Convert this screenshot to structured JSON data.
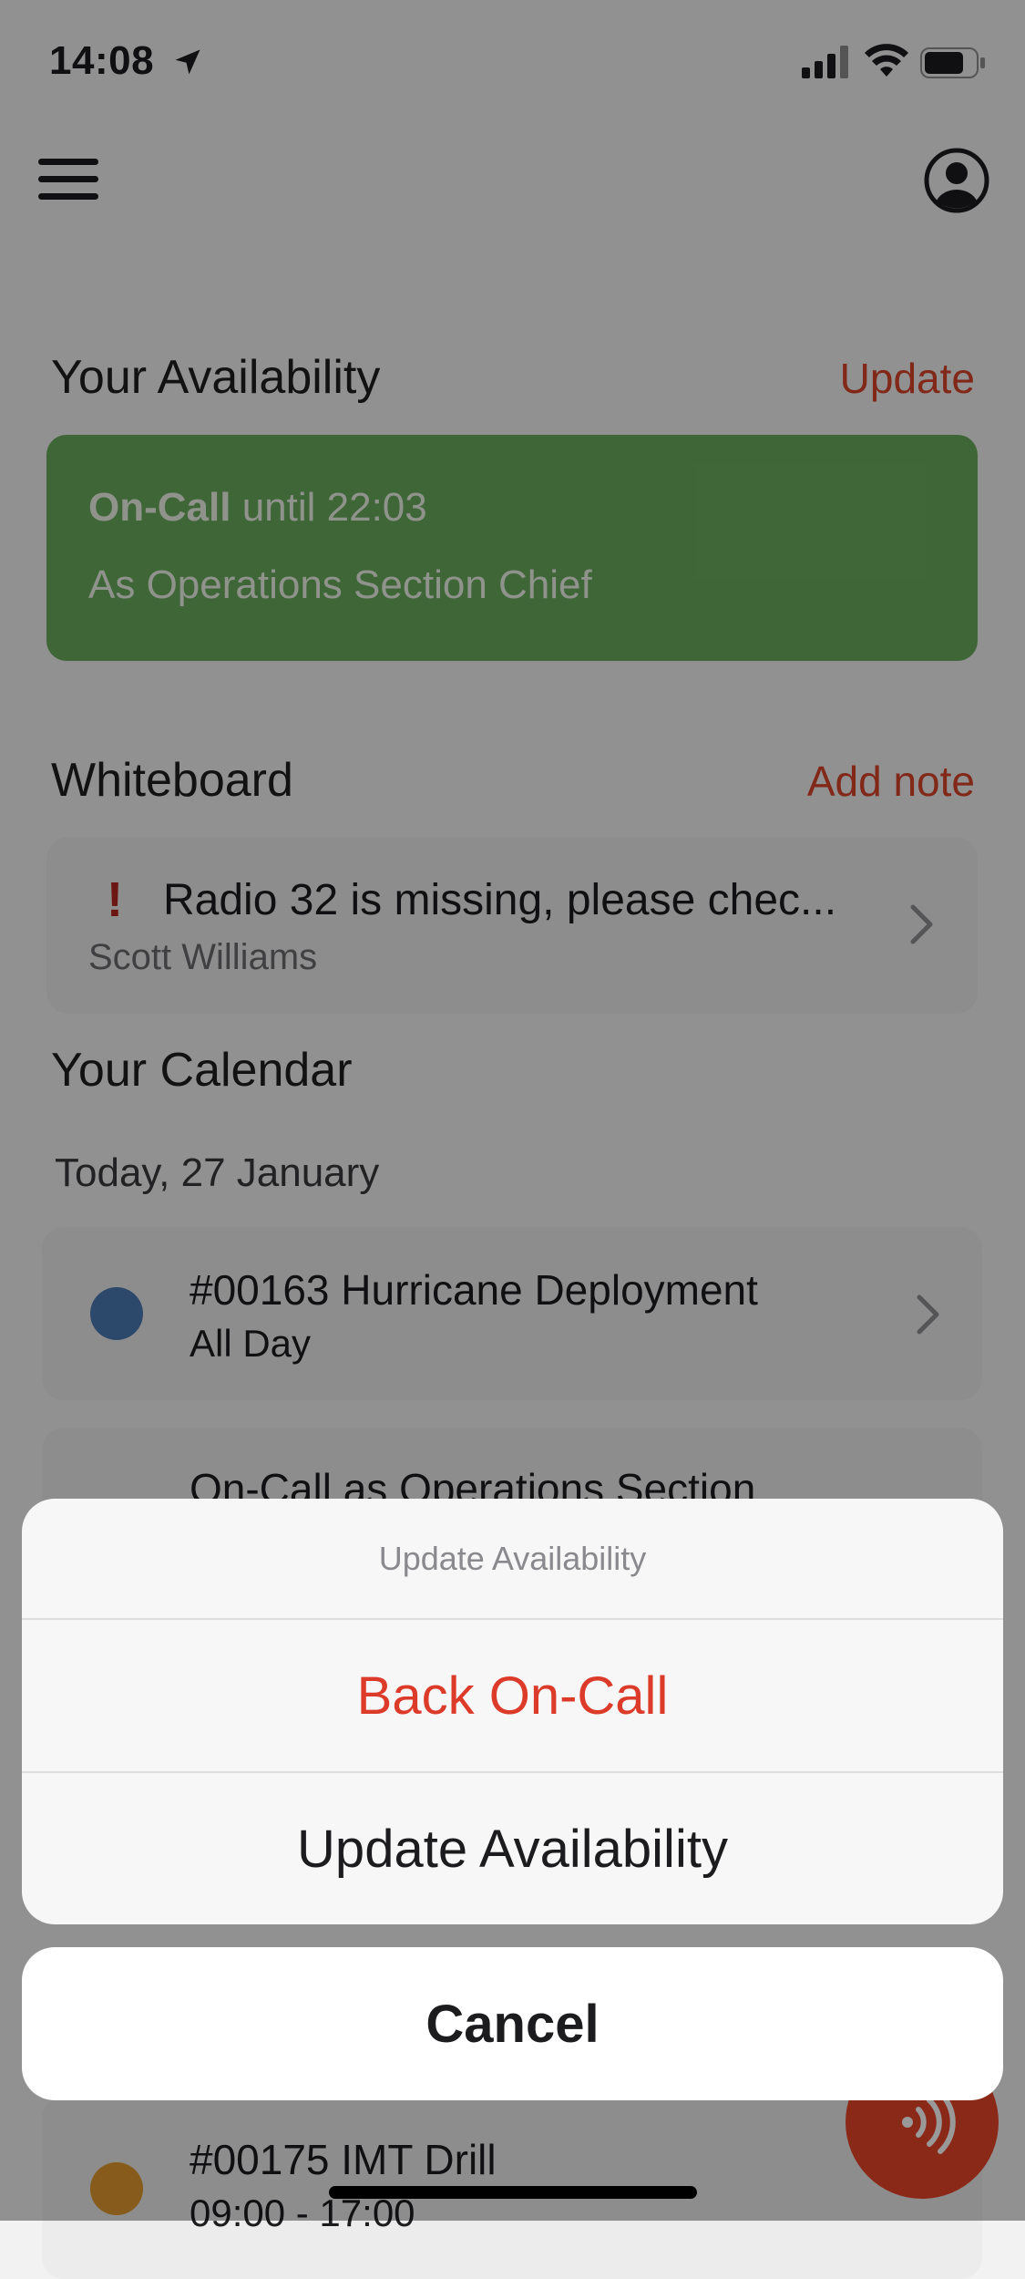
{
  "status_bar": {
    "time": "14:08"
  },
  "availability": {
    "section_title": "Your Availability",
    "update_link": "Update",
    "status": "On-Call",
    "until": "until 22:03",
    "role": "As Operations Section Chief",
    "card_color": "#6aab5d"
  },
  "whiteboard": {
    "section_title": "Whiteboard",
    "add_link": "Add note",
    "note_mark": "!",
    "note_title": "Radio 32 is missing, please chec...",
    "note_author": "Scott Williams"
  },
  "calendar": {
    "section_title": "Your Calendar",
    "date_label": "Today, 27 January",
    "events": [
      {
        "title": "#00163 Hurricane Deployment",
        "time": "All Day",
        "dot_color": "#4a78b3"
      },
      {
        "title": "On-Call as Operations Section",
        "time": ""
      },
      {
        "title": "#00175 IMT Drill",
        "time": "09:00 - 17:00",
        "dot_color": "#e0982e"
      }
    ]
  },
  "action_sheet": {
    "title": "Update Availability",
    "primary": "Back On-Call",
    "secondary": "Update Availability",
    "cancel": "Cancel"
  },
  "colors": {
    "accent": "#d8442b",
    "fab": "#e8452a"
  },
  "icons": [
    "location-arrow-icon",
    "signal-icon",
    "wifi-icon",
    "battery-icon",
    "menu-icon",
    "profile-icon",
    "chevron-right-icon",
    "radio-waves-icon"
  ]
}
